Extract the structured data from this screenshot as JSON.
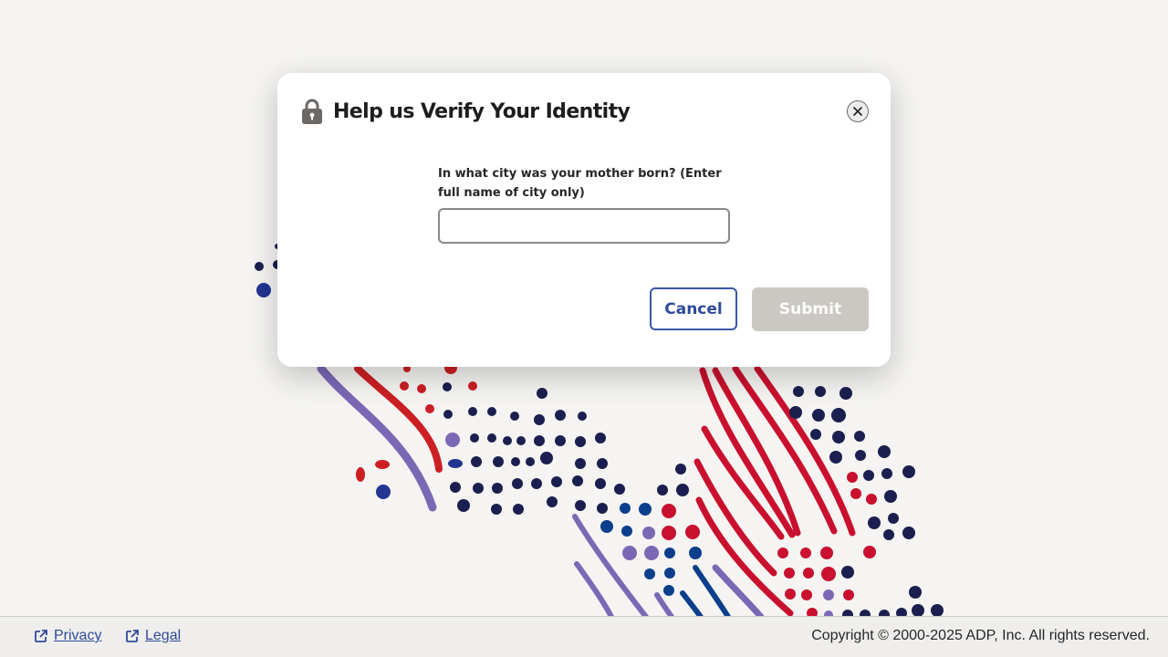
{
  "dialog": {
    "title": "Help us Verify Your Identity",
    "question_label": "In what city was your mother born? (Enter full name of city only)",
    "answer_value": "",
    "cancel_label": "Cancel",
    "submit_label": "Submit",
    "icons": {
      "title": "lock-icon",
      "close": "close-icon"
    }
  },
  "footer": {
    "links": [
      {
        "label": "Privacy",
        "icon": "external-link-icon"
      },
      {
        "label": "Legal",
        "icon": "external-link-icon"
      }
    ],
    "copyright": "Copyright © 2000-2025 ADP, Inc. All rights reserved."
  },
  "colors": {
    "background": "#f5f4f2",
    "accent": "#2e4a9a",
    "submit_disabled": "#cbc8c3",
    "navy": "#1b1f4f",
    "red": "#c9102e",
    "purple": "#7b68b5",
    "blue": "#0b3f8c"
  }
}
